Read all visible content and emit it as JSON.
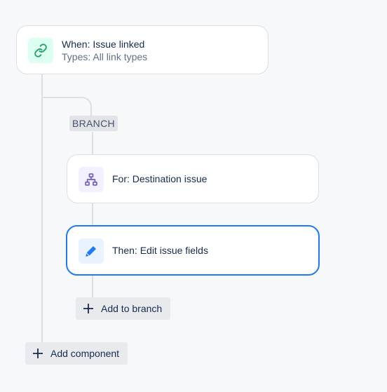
{
  "trigger": {
    "title": "When: Issue linked",
    "subtitle": "Types: All link types",
    "icon": "link-icon",
    "icon_color": "#22a06b",
    "icon_bg": "#dcfff1"
  },
  "branch": {
    "label": "BRANCH",
    "condition": {
      "title": "For: Destination issue",
      "icon": "hierarchy-icon",
      "icon_color": "#6e5dc6",
      "icon_bg": "#f3f0ff"
    },
    "action": {
      "title": "Then: Edit issue fields",
      "icon": "pencil-icon",
      "icon_color": "#1d7afc",
      "icon_bg": "#e9f2ff"
    },
    "add_label": "Add to branch"
  },
  "add_component_label": "Add component",
  "colors": {
    "selected_border": "#1d7afc",
    "connector": "#dcdfe4",
    "background": "#f7f8f9"
  }
}
